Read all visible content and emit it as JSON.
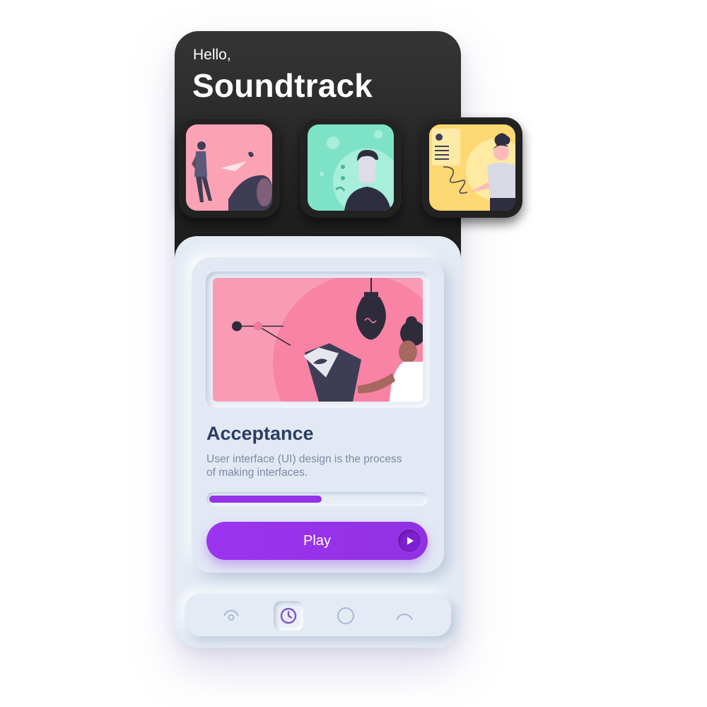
{
  "header": {
    "greeting": "Hello,",
    "title": "Soundtrack"
  },
  "playlists": [
    {
      "name": "thumbnail-pink",
      "color": "#fba3b4"
    },
    {
      "name": "thumbnail-mint",
      "color": "#7ee3c6"
    },
    {
      "name": "thumbnail-yellow",
      "color": "#fed872"
    }
  ],
  "now_playing": {
    "title": "Acceptance",
    "description": "User interface (UI) design is the process of making interfaces.",
    "progress_fraction": 0.52,
    "play_label": "Play"
  },
  "navigation": {
    "items": [
      {
        "icon": "signal-icon",
        "active": false
      },
      {
        "icon": "clock-icon",
        "active": true
      },
      {
        "icon": "circle-icon",
        "active": false
      },
      {
        "icon": "arc-icon",
        "active": false
      }
    ]
  },
  "colors": {
    "accent": "#9432e8",
    "header_background": "#1f1f1f",
    "body_background": "#e4ebf5",
    "title_text": "#2c3e63"
  }
}
